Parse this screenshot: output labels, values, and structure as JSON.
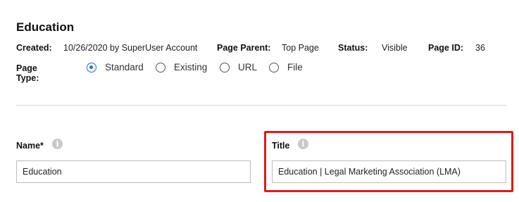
{
  "page": {
    "title": "Education"
  },
  "meta": {
    "created_label": "Created:",
    "created_value": "10/26/2020 by SuperUser Account",
    "parent_label": "Page Parent:",
    "parent_value": "Top Page",
    "status_label": "Status:",
    "status_value": "Visible",
    "pageid_label": "Page ID:",
    "pageid_value": "36"
  },
  "page_type": {
    "label": "Page Type:",
    "options": [
      {
        "label": "Standard",
        "checked": true
      },
      {
        "label": "Existing",
        "checked": false
      },
      {
        "label": "URL",
        "checked": false
      },
      {
        "label": "File",
        "checked": false
      }
    ]
  },
  "fields": {
    "name": {
      "label": "Name*",
      "value": "Education",
      "info_icon": "info-icon"
    },
    "title": {
      "label": "Title",
      "value": "Education | Legal Marketing Association (LMA)",
      "info_icon": "info-icon"
    }
  },
  "colors": {
    "accent": "#1f6fc9",
    "highlight": "#e01a1a"
  }
}
